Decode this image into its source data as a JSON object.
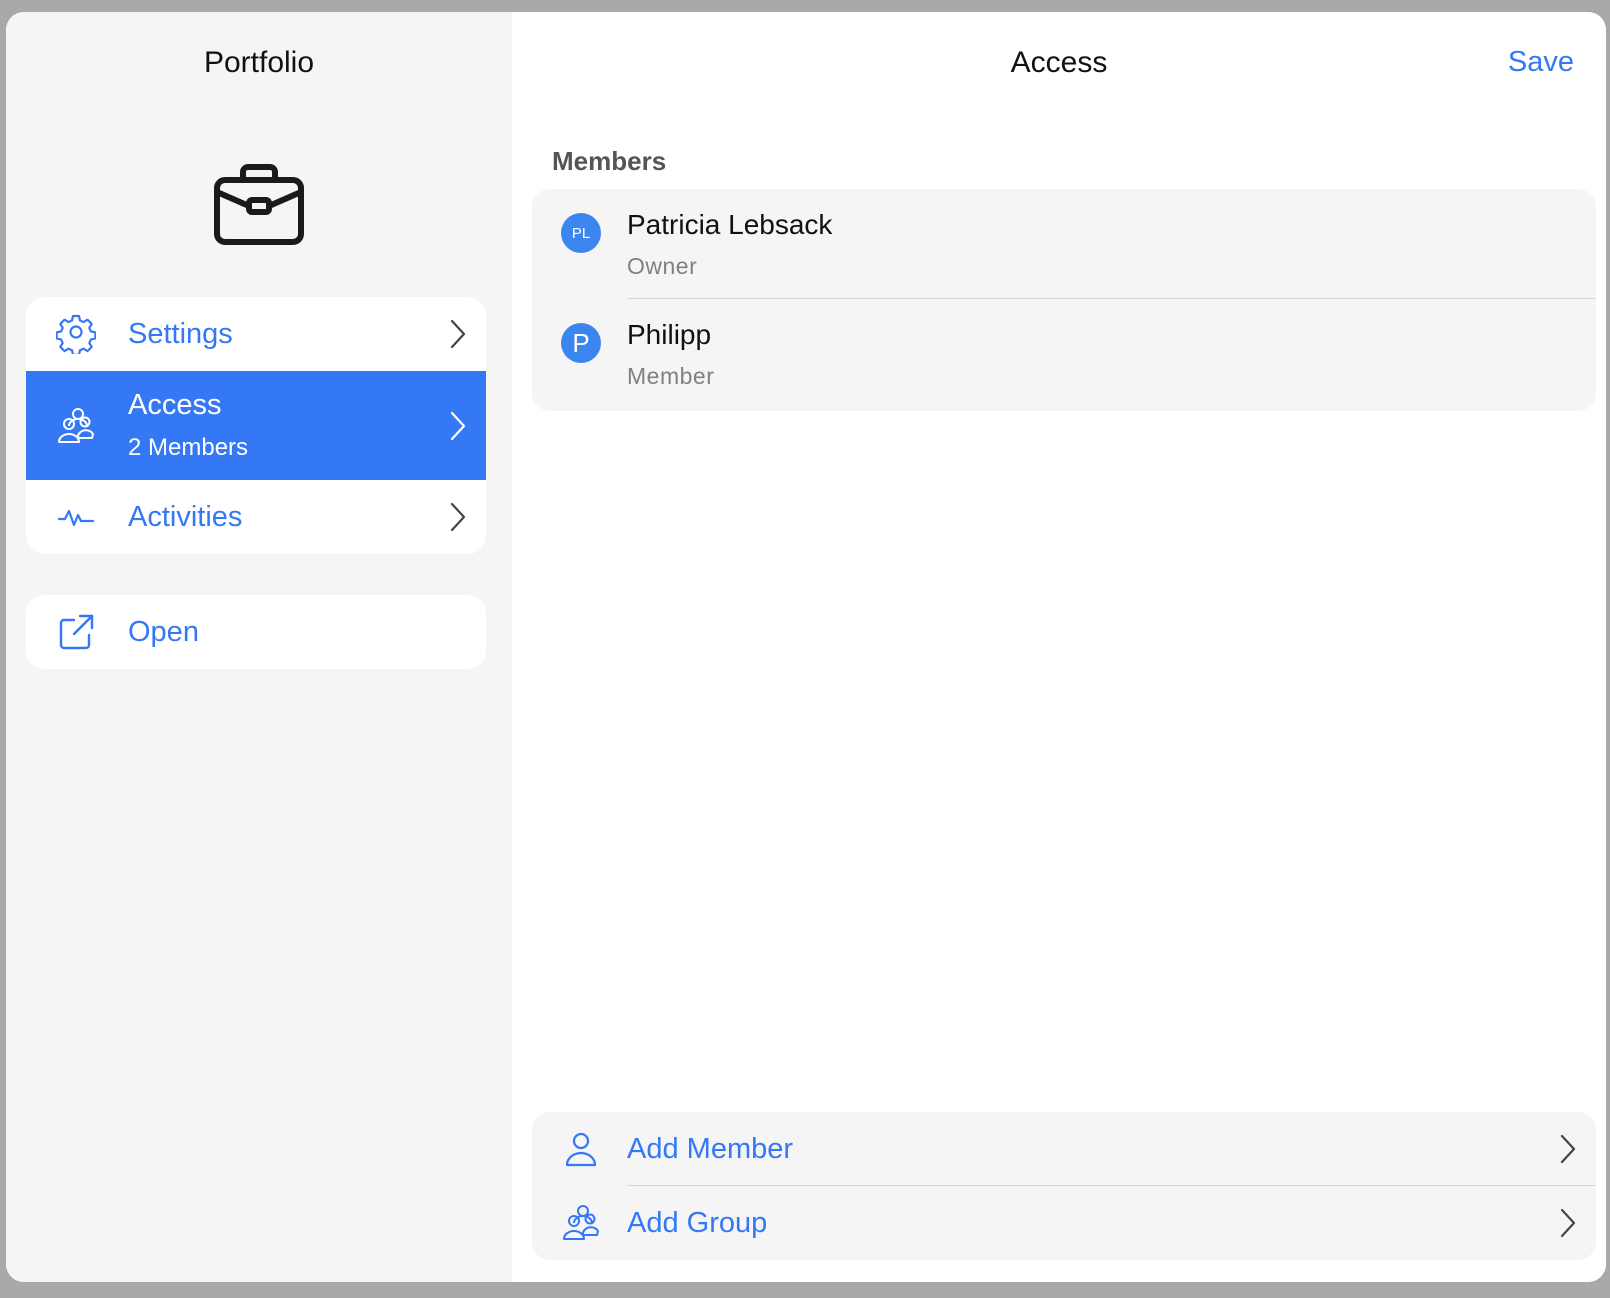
{
  "sidebar": {
    "title": "Portfolio",
    "icon": "briefcase-icon",
    "items": [
      {
        "label": "Settings",
        "icon": "gear-icon",
        "selected": false
      },
      {
        "label": "Access",
        "sublabel": "2 Members",
        "icon": "group-icon",
        "selected": true
      },
      {
        "label": "Activities",
        "icon": "activity-icon",
        "selected": false
      }
    ],
    "secondary_items": [
      {
        "label": "Open",
        "icon": "external-link-icon"
      }
    ]
  },
  "main": {
    "title": "Access",
    "save_label": "Save",
    "section_header": "Members",
    "members": [
      {
        "initials": "PL",
        "name": "Patricia Lebsack",
        "role": "Owner"
      },
      {
        "initials": "P",
        "name": "Philipp",
        "role": "Member"
      }
    ],
    "actions": [
      {
        "label": "Add Member",
        "icon": "person-icon"
      },
      {
        "label": "Add Group",
        "icon": "group-icon"
      }
    ]
  },
  "colors": {
    "accent": "#3478f6",
    "avatar": "#3a86ee",
    "sidebar_bg": "#f5f5f5",
    "card_bg": "#f5f5f5"
  }
}
